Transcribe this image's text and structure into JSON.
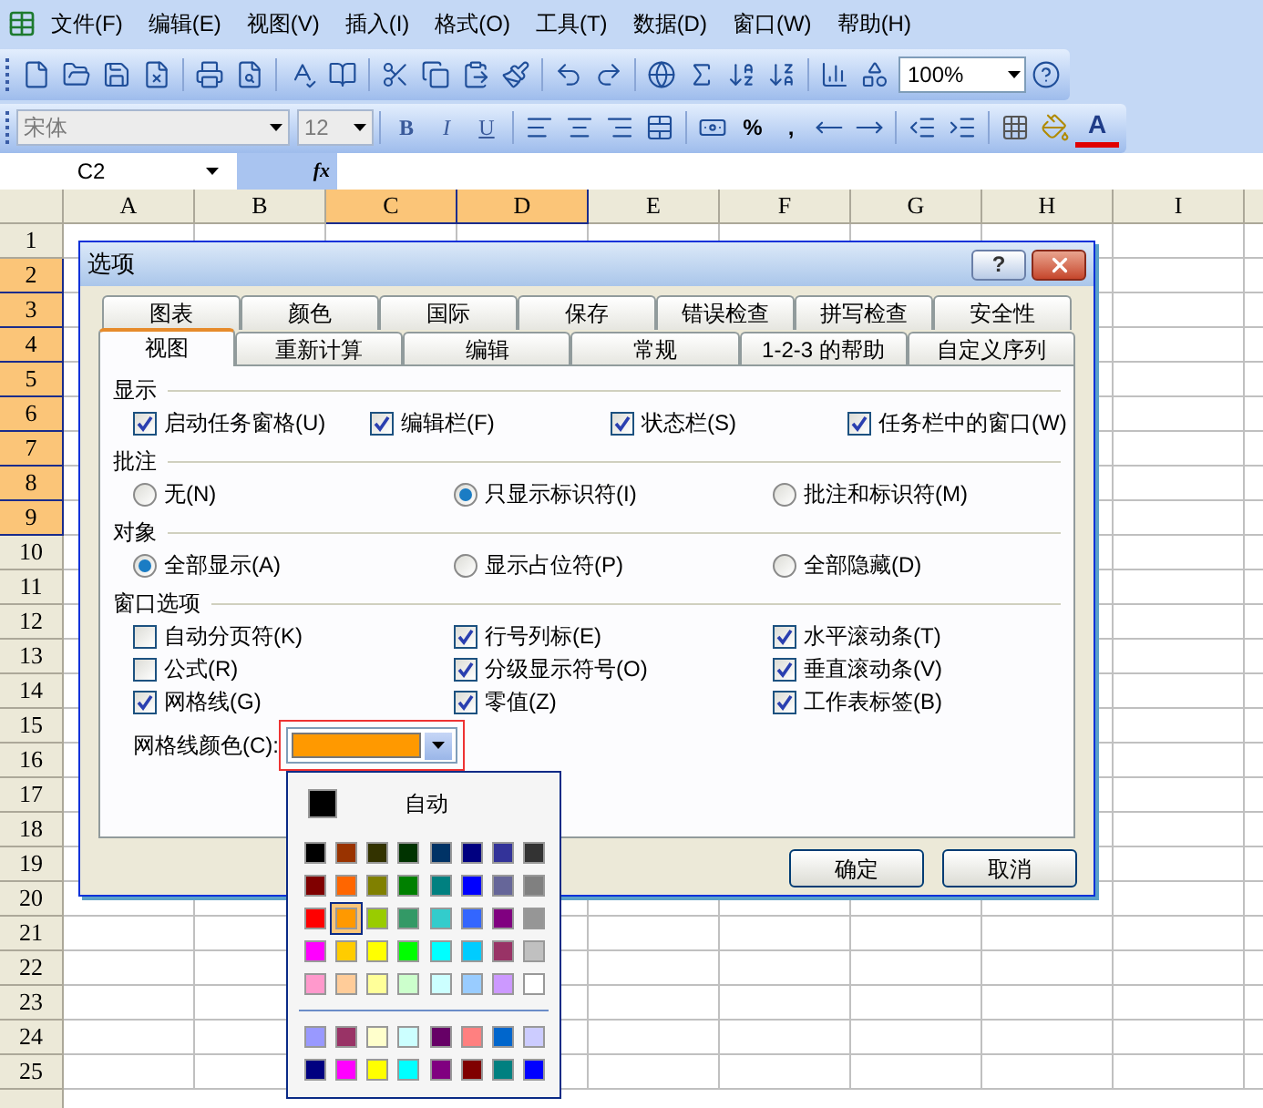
{
  "menu_bar": {
    "items": [
      "文件(F)",
      "编辑(E)",
      "视图(V)",
      "插入(I)",
      "格式(O)",
      "工具(T)",
      "数据(D)",
      "窗口(W)",
      "帮助(H)"
    ]
  },
  "standard_toolbar": {
    "zoom": "100%"
  },
  "formatting_toolbar": {
    "font": "宋体",
    "size": "12",
    "bold": "B",
    "italic": "I",
    "underline": "U",
    "percent": "%",
    "comma": ",",
    "font_color": "A"
  },
  "formula_bar": {
    "name_box": "C2",
    "fx": "fx"
  },
  "sheet": {
    "columns": [
      {
        "label": "A",
        "selected": false
      },
      {
        "label": "B",
        "selected": false
      },
      {
        "label": "C",
        "selected": true
      },
      {
        "label": "D",
        "selected": true
      },
      {
        "label": "E",
        "selected": false
      },
      {
        "label": "F",
        "selected": false
      },
      {
        "label": "G",
        "selected": false
      },
      {
        "label": "H",
        "selected": false
      },
      {
        "label": "I",
        "selected": false
      }
    ],
    "rows": [
      {
        "label": "1",
        "selected": false
      },
      {
        "label": "2",
        "selected": true
      },
      {
        "label": "3",
        "selected": true
      },
      {
        "label": "4",
        "selected": true
      },
      {
        "label": "5",
        "selected": true
      },
      {
        "label": "6",
        "selected": true
      },
      {
        "label": "7",
        "selected": true
      },
      {
        "label": "8",
        "selected": true
      },
      {
        "label": "9",
        "selected": true
      },
      {
        "label": "10",
        "selected": false
      },
      {
        "label": "11",
        "selected": false
      },
      {
        "label": "12",
        "selected": false
      },
      {
        "label": "13",
        "selected": false
      },
      {
        "label": "14",
        "selected": false
      },
      {
        "label": "15",
        "selected": false
      },
      {
        "label": "16",
        "selected": false
      },
      {
        "label": "17",
        "selected": false
      },
      {
        "label": "18",
        "selected": false
      },
      {
        "label": "19",
        "selected": false
      },
      {
        "label": "20",
        "selected": false
      },
      {
        "label": "21",
        "selected": false
      },
      {
        "label": "22",
        "selected": false
      },
      {
        "label": "23",
        "selected": false
      },
      {
        "label": "24",
        "selected": false
      },
      {
        "label": "25",
        "selected": false
      }
    ]
  },
  "dialog": {
    "title": "选项",
    "help_button": "?",
    "tabs_back": [
      {
        "label": "图表",
        "selected": false
      },
      {
        "label": "颜色",
        "selected": false
      },
      {
        "label": "国际",
        "selected": false
      },
      {
        "label": "保存",
        "selected": false
      },
      {
        "label": "错误检查",
        "selected": false
      },
      {
        "label": "拼写检查",
        "selected": false
      },
      {
        "label": "安全性",
        "selected": false
      }
    ],
    "tabs_front": [
      {
        "label": "视图",
        "selected": true
      },
      {
        "label": "重新计算",
        "selected": false
      },
      {
        "label": "编辑",
        "selected": false
      },
      {
        "label": "常规",
        "selected": false
      },
      {
        "label": "1-2-3 的帮助",
        "selected": false
      },
      {
        "label": "自定义序列",
        "selected": false
      }
    ],
    "sections": [
      {
        "title": "显示",
        "kind": "checkbox",
        "items": [
          {
            "label": "启动任务窗格(U)",
            "checked": true
          },
          {
            "label": "编辑栏(F)",
            "checked": true
          },
          {
            "label": "状态栏(S)",
            "checked": true
          },
          {
            "label": "任务栏中的窗口(W)",
            "checked": true
          }
        ]
      },
      {
        "title": "批注",
        "kind": "radio",
        "items": [
          {
            "label": "无(N)",
            "selected": false
          },
          {
            "label": "只显示标识符(I)",
            "selected": true
          },
          {
            "label": "批注和标识符(M)",
            "selected": false
          }
        ]
      },
      {
        "title": "对象",
        "kind": "radio",
        "items": [
          {
            "label": "全部显示(A)",
            "selected": true
          },
          {
            "label": "显示占位符(P)",
            "selected": false
          },
          {
            "label": "全部隐藏(D)",
            "selected": false
          }
        ]
      },
      {
        "title": "窗口选项",
        "kind": "checkbox",
        "items": [
          {
            "label": "自动分页符(K)",
            "checked": false
          },
          {
            "label": "行号列标(E)",
            "checked": true
          },
          {
            "label": "水平滚动条(T)",
            "checked": true
          },
          {
            "label": "公式(R)",
            "checked": false
          },
          {
            "label": "分级显示符号(O)",
            "checked": true
          },
          {
            "label": "垂直滚动条(V)",
            "checked": true
          },
          {
            "label": "网格线(G)",
            "checked": true
          },
          {
            "label": "零值(Z)",
            "checked": true
          },
          {
            "label": "工作表标签(B)",
            "checked": true
          }
        ]
      }
    ],
    "gridline_color": {
      "label": "网格线颜色(C):",
      "color": "#ff9900"
    },
    "buttons": [
      "确定",
      "取消"
    ]
  },
  "color_dropdown": {
    "automatic": {
      "label": "自动",
      "color": "#000000"
    },
    "swatches": [
      {
        "color": "#000000",
        "selected": false
      },
      {
        "color": "#993300",
        "selected": false
      },
      {
        "color": "#333300",
        "selected": false
      },
      {
        "color": "#003300",
        "selected": false
      },
      {
        "color": "#003366",
        "selected": false
      },
      {
        "color": "#000080",
        "selected": false
      },
      {
        "color": "#333399",
        "selected": false
      },
      {
        "color": "#333333",
        "selected": false
      },
      {
        "color": "#800000",
        "selected": false
      },
      {
        "color": "#ff6600",
        "selected": false
      },
      {
        "color": "#808000",
        "selected": false
      },
      {
        "color": "#008000",
        "selected": false
      },
      {
        "color": "#008080",
        "selected": false
      },
      {
        "color": "#0000ff",
        "selected": false
      },
      {
        "color": "#666699",
        "selected": false
      },
      {
        "color": "#808080",
        "selected": false
      },
      {
        "color": "#ff0000",
        "selected": false
      },
      {
        "color": "#ff9900",
        "selected": true
      },
      {
        "color": "#99cc00",
        "selected": false
      },
      {
        "color": "#339966",
        "selected": false
      },
      {
        "color": "#33cccc",
        "selected": false
      },
      {
        "color": "#3366ff",
        "selected": false
      },
      {
        "color": "#800080",
        "selected": false
      },
      {
        "color": "#969696",
        "selected": false
      },
      {
        "color": "#ff00ff",
        "selected": false
      },
      {
        "color": "#ffcc00",
        "selected": false
      },
      {
        "color": "#ffff00",
        "selected": false
      },
      {
        "color": "#00ff00",
        "selected": false
      },
      {
        "color": "#00ffff",
        "selected": false
      },
      {
        "color": "#00ccff",
        "selected": false
      },
      {
        "color": "#993366",
        "selected": false
      },
      {
        "color": "#c0c0c0",
        "selected": false
      },
      {
        "color": "#ff99cc",
        "selected": false
      },
      {
        "color": "#ffcc99",
        "selected": false
      },
      {
        "color": "#ffff99",
        "selected": false
      },
      {
        "color": "#ccffcc",
        "selected": false
      },
      {
        "color": "#ccffff",
        "selected": false
      },
      {
        "color": "#99ccff",
        "selected": false
      },
      {
        "color": "#cc99ff",
        "selected": false
      },
      {
        "color": "#ffffff",
        "selected": false
      }
    ],
    "chart_swatches": [
      {
        "color": "#9999ff",
        "selected": false
      },
      {
        "color": "#993366",
        "selected": false
      },
      {
        "color": "#ffffcc",
        "selected": false
      },
      {
        "color": "#ccffff",
        "selected": false
      },
      {
        "color": "#660066",
        "selected": false
      },
      {
        "color": "#ff8080",
        "selected": false
      },
      {
        "color": "#0066cc",
        "selected": false
      },
      {
        "color": "#ccccff",
        "selected": false
      },
      {
        "color": "#000080",
        "selected": false
      },
      {
        "color": "#ff00ff",
        "selected": false
      },
      {
        "color": "#ffff00",
        "selected": false
      },
      {
        "color": "#00ffff",
        "selected": false
      },
      {
        "color": "#800080",
        "selected": false
      },
      {
        "color": "#800000",
        "selected": false
      },
      {
        "color": "#008080",
        "selected": false
      },
      {
        "color": "#0000ff",
        "selected": false
      }
    ]
  }
}
